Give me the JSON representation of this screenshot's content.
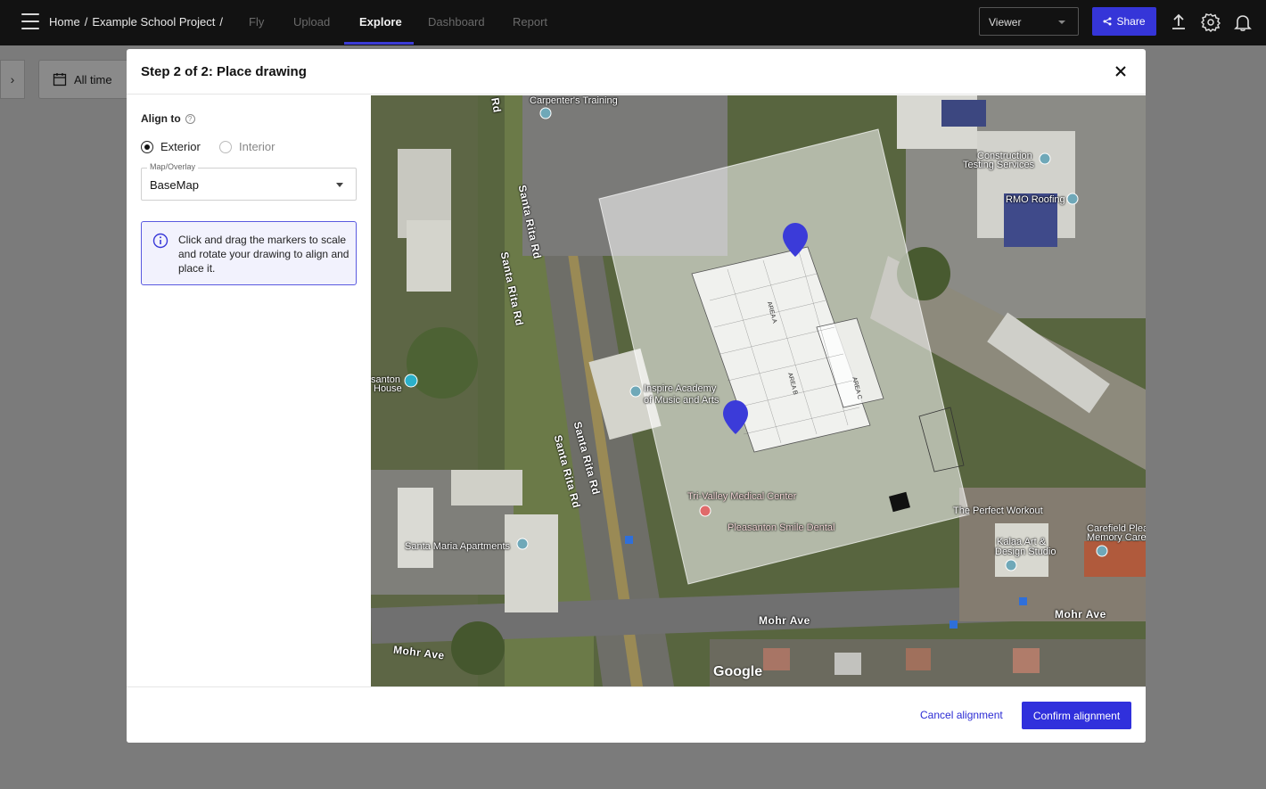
{
  "topbar": {
    "breadcrumb": {
      "home": "Home",
      "sep1": "/",
      "project": "Example School Project",
      "sep2": "/"
    },
    "nav": {
      "fly": "Fly",
      "upload": "Upload",
      "explore": "Explore",
      "dashboard": "Dashboard",
      "report": "Report"
    },
    "viewer": "Viewer",
    "share": "Share",
    "icons": [
      "menu-icon",
      "upload-icon",
      "gear-icon",
      "bell-icon"
    ]
  },
  "background": {
    "all_time": "All time"
  },
  "modal": {
    "title": "Step 2 of 2: Place drawing",
    "align_to_label": "Align to",
    "options": {
      "exterior": "Exterior",
      "interior": "Interior"
    },
    "selected_option": "Exterior",
    "map_overlay": {
      "legend": "Map/Overlay",
      "value": "BaseMap"
    },
    "info_text": "Click and drag the markers to scale and rotate your drawing to align and place it.",
    "cancel_label": "Cancel alignment",
    "confirm_label": "Confirm alignment"
  },
  "map": {
    "labels": {
      "carpenters": "Carpenter's Training",
      "construction": "Construction",
      "testing": "Testing Services",
      "rmo": "RMO Roofing",
      "inspire1": "Inspire Academy",
      "inspire2": "of Music and Arts",
      "pleasanton1": "santon",
      "pleasanton2": "House",
      "trivalley": "Tri-Valley Medical Center",
      "pleasanton_dental": "Pleasanton Smile Dental",
      "santa_maria": "Santa Maria Apartments",
      "perfect": "The Perfect Workout",
      "kalaa1": "Kalaa Art &",
      "kalaa2": "Design Studio",
      "carefield1": "Carefield Plea",
      "carefield2": "Memory Care",
      "rd_top": "Rd",
      "area_a": "AREA A",
      "area_b": "AREA B",
      "area_c": "AREA C"
    },
    "roads": {
      "santa_rita_1": "Santa Rita Rd",
      "santa_rita_2": "Santa Rita Rd",
      "santa_rita_3": "Santa Rita Rd",
      "santa_rita_4": "Santa Rita Rd",
      "mohr_1": "Mohr Ave",
      "mohr_2": "Mohr Ave",
      "mohr_3": "Mohr Ave"
    },
    "google": "Google",
    "marker_color": "#3b3bd9"
  }
}
